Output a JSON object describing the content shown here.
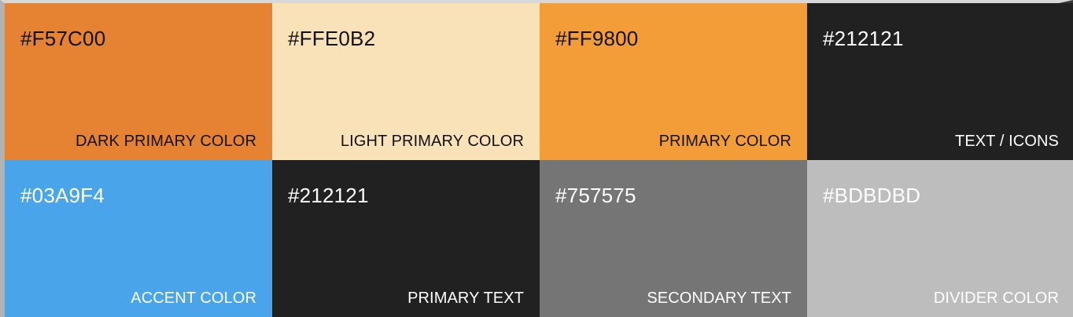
{
  "palette": {
    "swatches": [
      {
        "hex": "#F57C00",
        "label": "DARK PRIMARY COLOR",
        "fill": "#E58332"
      },
      {
        "hex": "#FFE0B2",
        "label": "LIGHT PRIMARY COLOR",
        "fill": "#F9E1B8"
      },
      {
        "hex": "#FF9800",
        "label": "PRIMARY COLOR",
        "fill": "#F29D38"
      },
      {
        "hex": "#212121",
        "label": "TEXT / ICONS",
        "fill": "#212121"
      },
      {
        "hex": "#03A9F4",
        "label": "ACCENT COLOR",
        "fill": "#4AA4EA"
      },
      {
        "hex": "#212121",
        "label": "PRIMARY TEXT",
        "fill": "#212121"
      },
      {
        "hex": "#757575",
        "label": "SECONDARY TEXT",
        "fill": "#757575"
      },
      {
        "hex": "#BDBDBD",
        "label": "DIVIDER COLOR",
        "fill": "#BDBDBD"
      }
    ]
  }
}
